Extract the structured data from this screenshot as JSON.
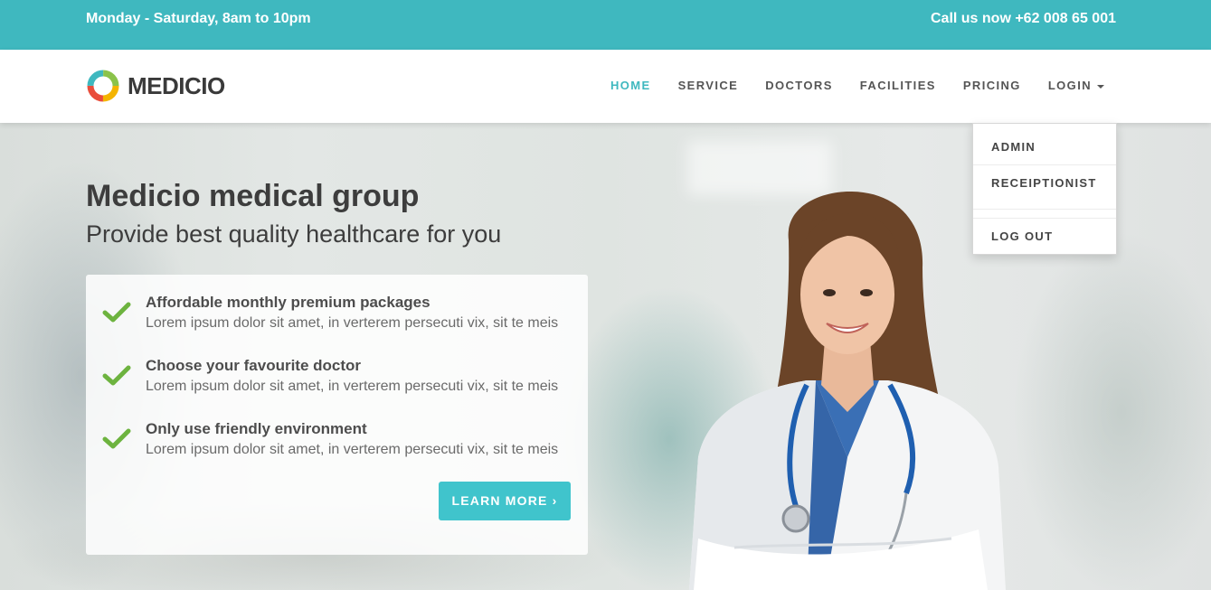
{
  "topbar": {
    "hours": "Monday - Saturday, 8am to 10pm",
    "phone": "Call us now +62 008 65 001"
  },
  "brand": {
    "name": "MEDICIO"
  },
  "nav": {
    "items": [
      {
        "label": "HOME",
        "active": true
      },
      {
        "label": "SERVICE"
      },
      {
        "label": "DOCTORS"
      },
      {
        "label": "FACILITIES"
      },
      {
        "label": "PRICING"
      },
      {
        "label": "LOGIN"
      }
    ]
  },
  "dropdown": {
    "items": [
      "ADMIN",
      "RECEIPTIONIST",
      "LOG OUT"
    ]
  },
  "hero": {
    "title": "Medicio medical group",
    "subtitle": "Provide best quality healthcare for you",
    "features": [
      {
        "title": "Affordable monthly premium packages",
        "desc": "Lorem ipsum dolor sit amet, in verterem persecuti vix, sit te meis"
      },
      {
        "title": "Choose your favourite doctor",
        "desc": "Lorem ipsum dolor sit amet, in verterem persecuti vix, sit te meis"
      },
      {
        "title": "Only use friendly environment",
        "desc": "Lorem ipsum dolor sit amet, in verterem persecuti vix, sit te meis"
      }
    ],
    "cta": "LEARN MORE ›"
  },
  "colors": {
    "accent": "#3fb8bf",
    "button": "#40c4cc",
    "check": "#6db33f"
  },
  "icons": [
    "medicio-logo-icon",
    "check-icon",
    "caret-down-icon"
  ]
}
